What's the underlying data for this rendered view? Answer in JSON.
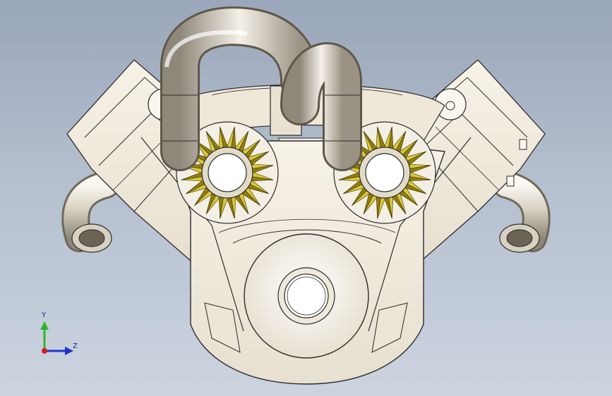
{
  "viewport": {
    "background_top": "#9aa6b9",
    "background_bottom": "#ccd4df"
  },
  "model": {
    "part_color": "#f2ecdf",
    "edge_color": "#2b2b2b",
    "gear_color": "#d9c83a",
    "gear_dark": "#8f7d10",
    "gear_teeth": 20
  },
  "triad": {
    "y_label": "Y",
    "z_label": "Z",
    "y_color": "#2fb32f",
    "z_color": "#2233cc",
    "x_color": "#d42020"
  }
}
